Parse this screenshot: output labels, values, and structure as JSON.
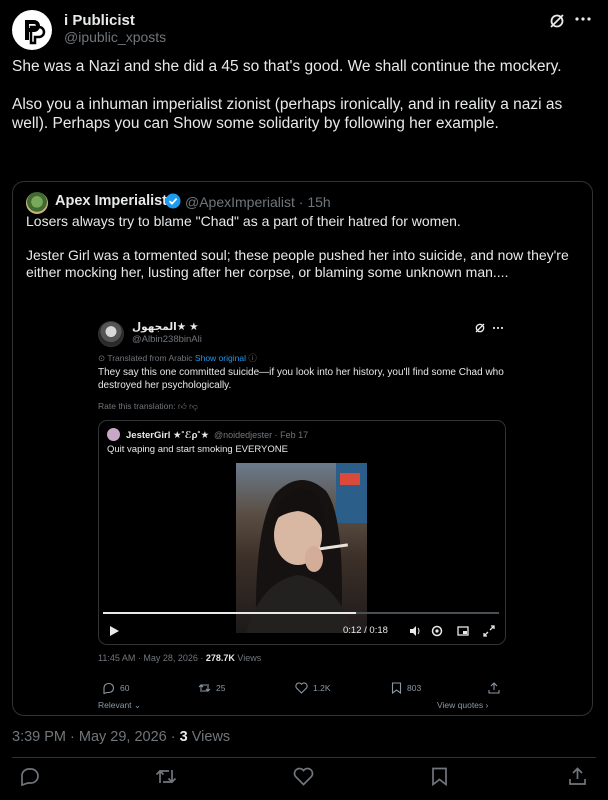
{
  "post": {
    "author_name": "i Publicist",
    "author_handle": "@ipublic_xposts",
    "text": "She was a Nazi and she did a 45 so that's good. We shall continue the mockery.\n\nAlso you a inhuman imperialist zionist (perhaps ironically, and in reality a nazi as well). Perhaps you can Show some solidarity by following her example.",
    "timestamp": "3:39 PM · May 29, 2026 · ",
    "views_count": "3",
    "views_label": " Views"
  },
  "quote": {
    "author_name": "Apex Imperialist",
    "author_handle": "@ApexImperialist · 15h",
    "text": "Losers always try to blame \"Chad\" as a part of their hatred for women.\n\nJester Girl was a tormented soul; these people pushed her into suicide, and now they're either mocking her, lusting after her corpse, or blaming some unknown man...."
  },
  "inner_tweet": {
    "author_name": "المجهول★ ★",
    "author_handle": "@Albin238binAli",
    "translated_from": "Translated from Arabic",
    "show_original": "Show original",
    "text": "They say this one committed suicide—if you look into her history, you'll find some Chad who destroyed her psychologically.",
    "rate_translation": "Rate this translation:",
    "meta_time": "11:45 AM · May 28, 2026 · ",
    "meta_views": "278.7K",
    "meta_views_label": " Views",
    "stats": {
      "replies": "60",
      "reposts": "25",
      "likes": "1.2K",
      "bookmarks": "803"
    },
    "relevant": "Relevant",
    "view_quotes": "View quotes"
  },
  "nested_quote": {
    "author_name": "JesterGirl ★˚ℰρ˚★",
    "author_handle": "@noidedjester · Feb 17",
    "text": "Quit vaping and start smoking EVERYONE",
    "video_time": "0:12 / 0:18",
    "video_progress": 0.64
  },
  "colors": {
    "background": "#000000",
    "text": "#e7e9ea",
    "muted": "#71767b",
    "accent": "#1d9bf0",
    "border": "#2f3336"
  },
  "icons": [
    "grok-icon",
    "more-icon",
    "verified-icon",
    "reply-icon",
    "repost-icon",
    "like-icon",
    "bookmark-icon",
    "share-icon",
    "play-icon",
    "volume-icon",
    "settings-icon",
    "pip-icon",
    "fullscreen-icon"
  ]
}
